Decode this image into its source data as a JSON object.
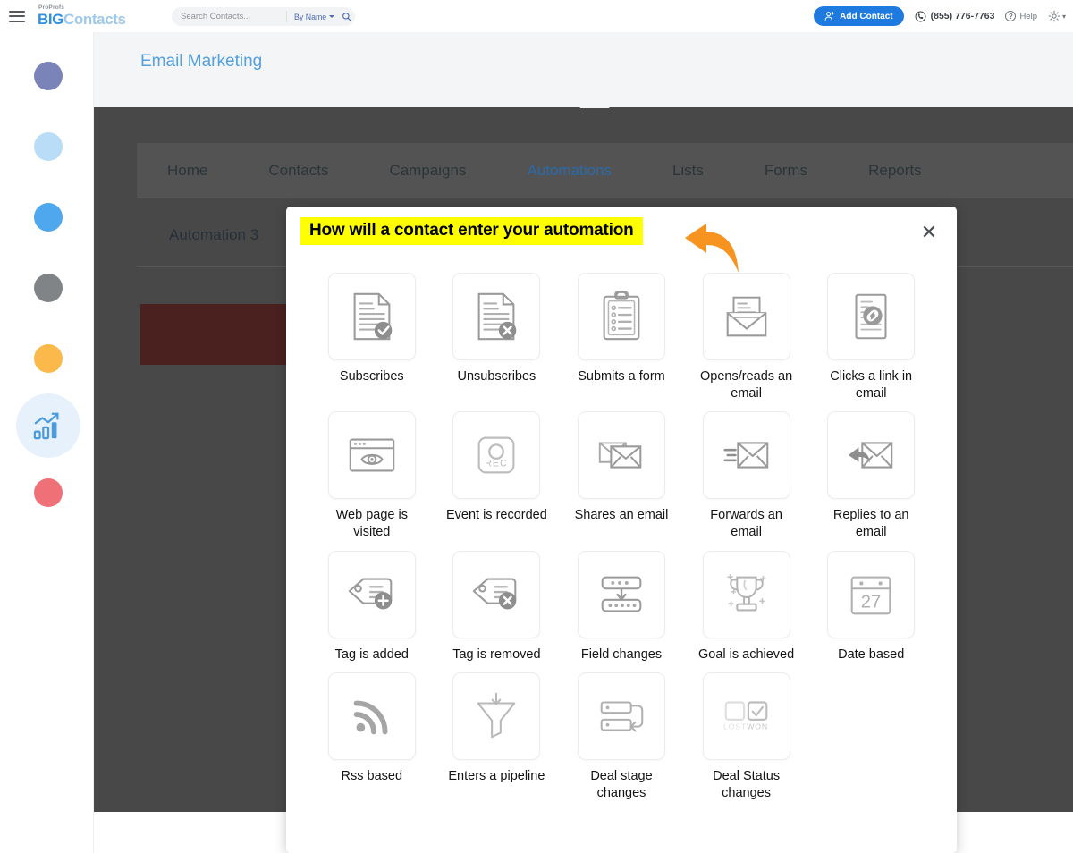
{
  "app": {
    "brand_pro": "ProProfs",
    "brand_big": "BIG",
    "brand_contacts": "Contacts"
  },
  "search": {
    "placeholder": "Search Contacts...",
    "value": "",
    "filter_label": "By Name"
  },
  "header_actions": {
    "add_contact_label": "Add Contact",
    "phone": "(855) 776-7763",
    "help_label": "Help",
    "help_glyph": "?",
    "gear_caret": "▾"
  },
  "sidebar": {
    "items": [
      {
        "name": "nav-dot-1",
        "color": "#7a84b8"
      },
      {
        "name": "nav-dot-2",
        "color": "#b9dcf7"
      },
      {
        "name": "nav-dot-3",
        "color": "#4fa7ee"
      },
      {
        "name": "nav-dot-4",
        "color": "#808487"
      },
      {
        "name": "nav-dot-5",
        "color": "#fbb84b"
      },
      {
        "name": "nav-reports-active",
        "color": "#e7f1fb"
      },
      {
        "name": "nav-dot-7",
        "color": "#ef7077"
      }
    ]
  },
  "page": {
    "title": "Email Marketing"
  },
  "nav": {
    "tabs": [
      {
        "label": "Home",
        "active": false
      },
      {
        "label": "Contacts",
        "active": false
      },
      {
        "label": "Campaigns",
        "active": false
      },
      {
        "label": "Automations",
        "active": true
      },
      {
        "label": "Lists",
        "active": false
      },
      {
        "label": "Forms",
        "active": false
      },
      {
        "label": "Reports",
        "active": false
      }
    ],
    "automation_name": "Automation 3"
  },
  "modal": {
    "title": "How will a contact enter your automation",
    "close_glyph": "✕",
    "highlight_color": "#ffff00",
    "arrow_color": "#f79420",
    "triggers": [
      {
        "label": "Subscribes",
        "icon": "document-check-icon"
      },
      {
        "label": "Unsubscribes",
        "icon": "document-x-icon"
      },
      {
        "label": "Submits a form",
        "icon": "clipboard-form-icon"
      },
      {
        "label": "Opens/reads an email",
        "icon": "open-envelope-icon"
      },
      {
        "label": "Clicks a link in email",
        "icon": "document-link-icon"
      },
      {
        "label": "Web page is visited",
        "icon": "browser-eye-icon"
      },
      {
        "label": "Event is recorded",
        "icon": "record-button-icon"
      },
      {
        "label": "Shares an email",
        "icon": "share-envelope-icon"
      },
      {
        "label": "Forwards an email",
        "icon": "forward-envelope-icon"
      },
      {
        "label": "Replies to an email",
        "icon": "reply-envelope-icon"
      },
      {
        "label": "Tag is added",
        "icon": "tag-plus-icon"
      },
      {
        "label": "Tag is removed",
        "icon": "tag-x-icon"
      },
      {
        "label": "Field changes",
        "icon": "field-change-icon"
      },
      {
        "label": "Goal is achieved",
        "icon": "trophy-icon"
      },
      {
        "label": "Date based",
        "icon": "calendar-27-icon",
        "calendar_day": "27"
      },
      {
        "label": "Rss based",
        "icon": "rss-icon"
      },
      {
        "label": "Enters a pipeline",
        "icon": "funnel-icon"
      },
      {
        "label": "Deal stage changes",
        "icon": "deal-stage-icon"
      },
      {
        "label": "Deal Status changes",
        "icon": "deal-status-icon",
        "lost_label": "LOST",
        "won_label": "WON"
      }
    ]
  }
}
